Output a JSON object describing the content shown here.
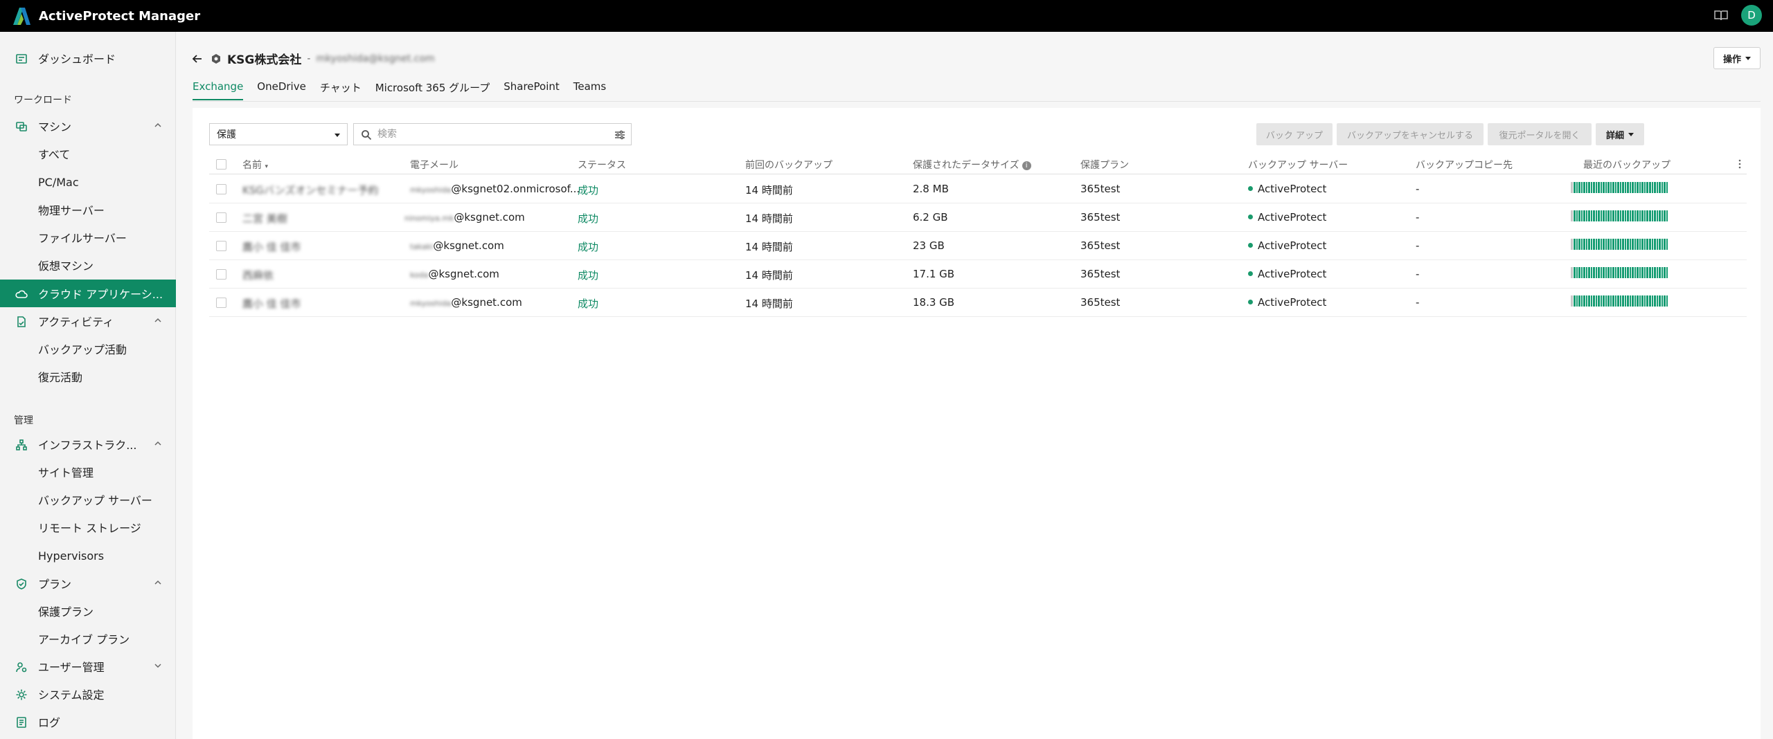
{
  "app": {
    "title": "ActiveProtect Manager",
    "user_initial": "D"
  },
  "sidebar": {
    "dashboard": "ダッシュボード",
    "section_workload": "ワークロード",
    "machines": "マシン",
    "all": "すべて",
    "pcmac": "PC/Mac",
    "physical_server": "物理サーバー",
    "file_server": "ファイルサーバー",
    "virtual_machine": "仮想マシン",
    "cloud_apps": "クラウド アプリケーシ...",
    "activity": "アクティビティ",
    "backup_activity": "バックアップ活動",
    "restore_activity": "復元活動",
    "section_manage": "管理",
    "infrastructure": "インフラストラク...",
    "site_management": "サイト管理",
    "backup_server": "バックアップ サーバー",
    "remote_storage": "リモート ストレージ",
    "hypervisors": "Hypervisors",
    "plans": "プラン",
    "protection_plan": "保護プラン",
    "archive_plan": "アーカイブ プラン",
    "user_management": "ユーザー管理",
    "system_settings": "システム設定",
    "log": "ログ"
  },
  "header": {
    "tenant_name": "KSG株式会社",
    "separator": "-",
    "tenant_email": "mkyoshida@ksgnet.com",
    "ops_label": "操作"
  },
  "tabs": [
    "Exchange",
    "OneDrive",
    "チャット",
    "Microsoft 365 グループ",
    "SharePoint",
    "Teams"
  ],
  "toolbar": {
    "filter_value": "保護",
    "search_placeholder": "検索",
    "backup": "バック アップ",
    "cancel_backup": "バックアップをキャンセルする",
    "open_restore_portal": "復元ポータルを開く",
    "details": "詳細"
  },
  "table": {
    "columns": {
      "name": "名前",
      "email": "電子メール",
      "status": "ステータス",
      "last_backup": "前回のバックアップ",
      "data_size": "保護されたデータサイズ",
      "plan": "保護プラン",
      "server": "バックアップ サーバー",
      "copy_dest": "バックアップコピー先",
      "recent": "最近のバックアップ"
    },
    "rows": [
      {
        "name": "KSGバンズオンセミナー予約",
        "email_prefix": "mkyoshida",
        "email_domain": "@ksgnet02.onmicrosof...",
        "status": "成功",
        "last_backup": "14 時間前",
        "size": "2.8 MB",
        "plan": "365test",
        "server": "ActiveProtect",
        "copy": "-",
        "recent_success": 1.0
      },
      {
        "name": "二宮 美樹",
        "email_prefix": "ninomiya.mk",
        "email_domain": "@ksgnet.com",
        "status": "成功",
        "last_backup": "14 時間前",
        "size": "6.2 GB",
        "plan": "365test",
        "server": "ActiveProtect",
        "copy": "-",
        "recent_success": 1.0
      },
      {
        "name": "鷹小 佳 佳市",
        "email_prefix": "takaki",
        "email_domain": "@ksgnet.com",
        "status": "成功",
        "last_backup": "14 時間前",
        "size": "23 GB",
        "plan": "365test",
        "server": "ActiveProtect",
        "copy": "-",
        "recent_success": 1.0
      },
      {
        "name": "西麻依",
        "email_prefix": "koda",
        "email_domain": "@ksgnet.com",
        "status": "成功",
        "last_backup": "14 時間前",
        "size": "17.1 GB",
        "plan": "365test",
        "server": "ActiveProtect",
        "copy": "-",
        "recent_success": 1.0
      },
      {
        "name": "鷹小 佳 佳市",
        "email_prefix": "mkyoshida",
        "email_domain": "@ksgnet.com",
        "status": "成功",
        "last_backup": "14 時間前",
        "size": "18.3 GB",
        "plan": "365test",
        "server": "ActiveProtect",
        "copy": "-",
        "recent_success": 1.0
      }
    ]
  }
}
